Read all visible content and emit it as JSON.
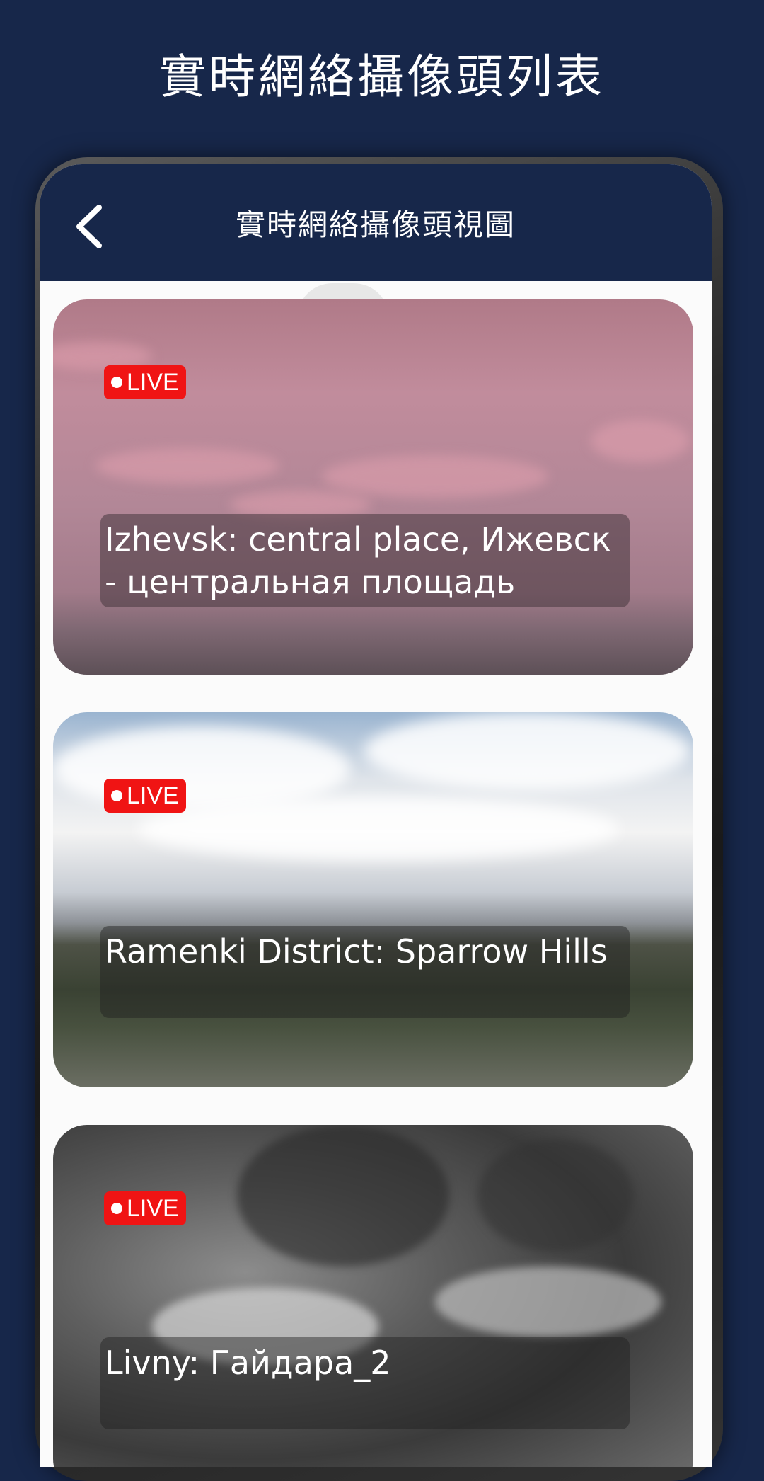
{
  "promo": {
    "title": "實時網絡攝像頭列表"
  },
  "header": {
    "title": "實時網絡攝像頭視圖",
    "back_icon": "chevron-left-icon"
  },
  "cameras": [
    {
      "name": "Izhevsk: central place, Ижевск - центральная площадь",
      "badge": "LIVE"
    },
    {
      "name": "Ramenki District: Sparrow Hills",
      "badge": "LIVE"
    },
    {
      "name": "Livny: Гайдара_2",
      "badge": "LIVE"
    }
  ],
  "colors": {
    "background": "#17274a",
    "live_badge": "#f01414",
    "screen": "#fbfbfb"
  }
}
